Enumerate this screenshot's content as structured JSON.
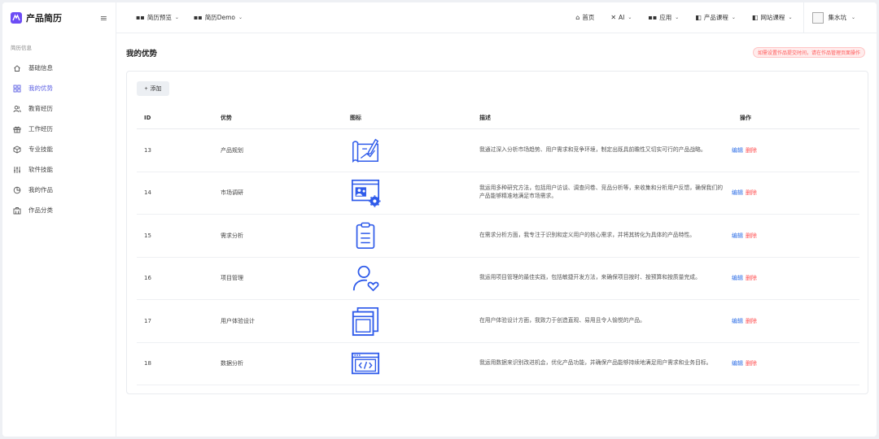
{
  "brand": {
    "title": "产品简历"
  },
  "sidebar": {
    "section_title": "简历信息",
    "items": [
      {
        "label": "基础信息",
        "icon": "home-icon"
      },
      {
        "label": "我的优势",
        "icon": "grid-icon"
      },
      {
        "label": "教育经历",
        "icon": "users-icon"
      },
      {
        "label": "工作经历",
        "icon": "gift-icon"
      },
      {
        "label": "专业技能",
        "icon": "cube-icon"
      },
      {
        "label": "软件技能",
        "icon": "sliders-icon"
      },
      {
        "label": "我的作品",
        "icon": "pie-icon"
      },
      {
        "label": "作品分类",
        "icon": "building-icon"
      }
    ]
  },
  "topbar": {
    "left": [
      {
        "label": "简历预览"
      },
      {
        "label": "简历Demo"
      }
    ],
    "right": [
      {
        "label": "首页"
      },
      {
        "label": "AI"
      },
      {
        "label": "应用"
      },
      {
        "label": "产品课程"
      },
      {
        "label": "网站课程"
      }
    ],
    "user": "集水坑"
  },
  "page": {
    "title": "我的优势",
    "tip": "如需设置作品提交时间，请在作品管理页面操作"
  },
  "toolbar": {
    "add_label": "添加"
  },
  "table": {
    "headers": {
      "id": "ID",
      "name": "优势",
      "icon": "图标",
      "desc": "描述",
      "ops": "操作"
    },
    "edit_label": "编辑",
    "delete_label": "删除",
    "rows": [
      {
        "id": "13",
        "name": "产品规划",
        "icon": "blueprint-pencil-icon",
        "desc": "我通过深入分析市场趋势、用户需求和竞争环境，制定出既具前瞻性又切实可行的产品战略。"
      },
      {
        "id": "14",
        "name": "市场调研",
        "icon": "presentation-gear-icon",
        "desc": "我运用多种研究方法，包括用户访谈、调查问卷、竞品分析等，来收集和分析用户反馈，确保我们的产品能够精准地满足市场需求。"
      },
      {
        "id": "15",
        "name": "需求分析",
        "icon": "clipboard-icon",
        "desc": "在需求分析方面，我专注于识别和定义用户的核心需求，并将其转化为具体的产品特性。"
      },
      {
        "id": "16",
        "name": "项目管理",
        "icon": "user-heart-icon",
        "desc": "我运用项目管理的最佳实践，包括敏捷开发方法，来确保项目按时、按预算和按质量完成。"
      },
      {
        "id": "17",
        "name": "用户体验设计",
        "icon": "window-layout-icon",
        "desc": "在用户体验设计方面，我致力于创造直观、易用且令人愉悦的产品。"
      },
      {
        "id": "18",
        "name": "数据分析",
        "icon": "code-window-icon",
        "desc": "我运用数据来识别改进机会，优化产品功能，并确保产品能够持续地满足用户需求和业务目标。"
      }
    ]
  },
  "colors": {
    "accent": "#5b5fe3",
    "brand": "#6c4cf5",
    "icon_blue": "#2f5bea",
    "edit": "#2f6fe6",
    "delete": "#ff4d4f"
  }
}
